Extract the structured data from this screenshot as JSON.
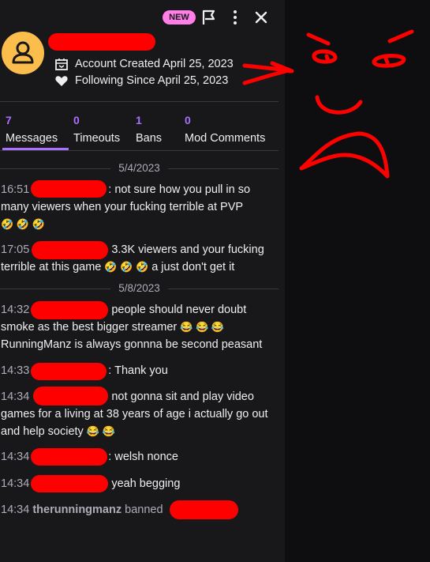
{
  "header": {
    "badge": "NEW",
    "account_created": "Account Created April 25, 2023",
    "following_since": "Following Since April 25, 2023"
  },
  "stats": [
    {
      "value": "7",
      "label": "Messages"
    },
    {
      "value": "0",
      "label": "Timeouts"
    },
    {
      "value": "1",
      "label": "Bans"
    },
    {
      "value": "0",
      "label": "Mod Comments"
    }
  ],
  "dates": [
    "5/4/2023",
    "5/8/2023"
  ],
  "messages": [
    {
      "time": "16:51",
      "text": ": not sure how you pull in so many viewers when your fucking terrible at PVP",
      "emotes": "🤣 🤣 🤣"
    },
    {
      "time": "17:05",
      "text": " 3.3K viewers and your fucking terrible at this game",
      "emotes": "🤣 🤣 🤣",
      "tail": " a just don't get it"
    },
    {
      "time": "14:32",
      "text": " people should never doubt smoke as the best bigger streamer",
      "emotes": "😂 😂 😂",
      "tail": " RunningManz is always gonnna be second peasant"
    },
    {
      "time": "14:33",
      "text": ": Thank you"
    },
    {
      "time": "14:34",
      "text": " not gonna sit and play video games for a living at 38 years of age i actually go out and help society",
      "emotes": "😂 😂"
    },
    {
      "time": "14:34",
      "text": ": welsh nonce"
    },
    {
      "time": "14:34",
      "text": " yeah begging"
    }
  ],
  "ban_event": {
    "time": "14:34",
    "moderator": "therunningmanz",
    "action": "banned",
    "suffix": "."
  },
  "colors": {
    "accent": "#a970ff",
    "badge": "#ff7ee8",
    "avatar": "#fbbd4b",
    "redaction": "#ff0000"
  },
  "icons": [
    "flag-icon",
    "more-vertical-icon",
    "close-icon",
    "user-icon",
    "calendar-icon",
    "heart-icon"
  ]
}
